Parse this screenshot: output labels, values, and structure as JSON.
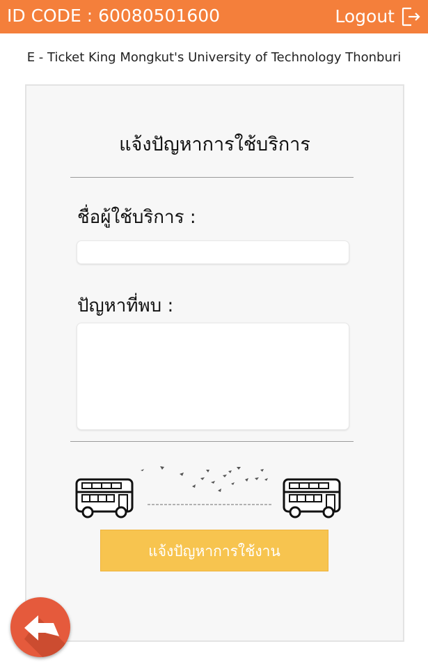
{
  "header": {
    "id_code": "ID CODE : 60080501600",
    "logout_label": "Logout",
    "logout_icon": "logout-icon",
    "background_color": "#f47f3b"
  },
  "subtitle": "E - Ticket King Mongkut's University of Technology Thonburi",
  "form": {
    "title": "แจ้งปัญหาการใช้บริการ",
    "name_label": "ชื่อผู้ใช้บริการ :",
    "name_value": "",
    "problem_label": "ปัญหาที่พบ :",
    "problem_value": "",
    "illustration_icon": "bus-road-birds-illustration",
    "submit_label": "แจ้งปัญหาการใช้งาน",
    "submit_color": "#f7c44f"
  },
  "back_button": {
    "icon": "back-arrow-icon",
    "color": "#e55a3c"
  }
}
